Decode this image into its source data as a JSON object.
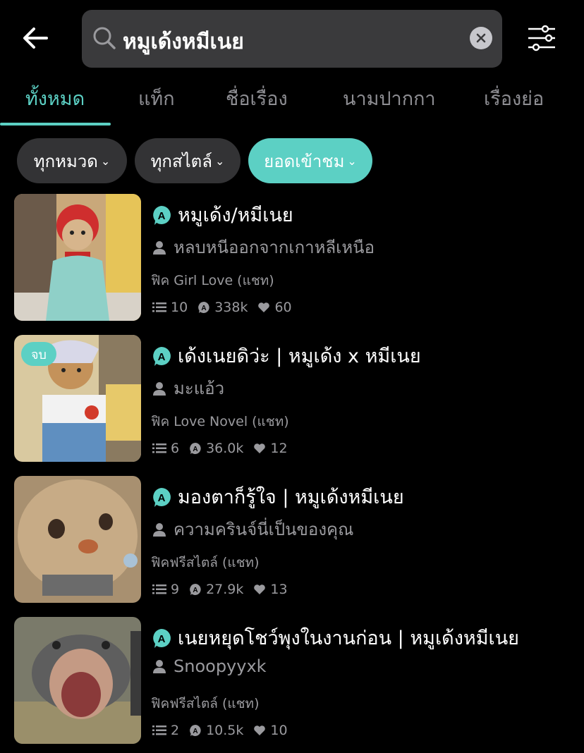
{
  "search": {
    "query": "หมูเด้งหมีเนย"
  },
  "tabs": [
    {
      "label": "ทั้งหมด",
      "active": true
    },
    {
      "label": "แท็ก",
      "active": false
    },
    {
      "label": "ชื่อเรื่อง",
      "active": false
    },
    {
      "label": "นามปากกา",
      "active": false
    },
    {
      "label": "เรื่องย่อ",
      "active": false
    }
  ],
  "filters": [
    {
      "label": "ทุกหมวด",
      "active": false
    },
    {
      "label": "ทุกสไตล์",
      "active": false
    },
    {
      "label": "ยอดเข้าชม",
      "active": true
    }
  ],
  "results": [
    {
      "title": "หมูเด้ง/หมีเนย",
      "author": "หลบหนีออกจากเกาหลีเหนือ",
      "category": "ฟิค Girl Love (แชท)",
      "chapters": "10",
      "views": "338k",
      "likes": "60",
      "badge": ""
    },
    {
      "title": "เด้งเนยดิว่ะ  | หมูเด้ง x หมีเนย",
      "author": "มะแอ้ว",
      "category": "ฟิค Love Novel (แชท)",
      "chapters": "6",
      "views": "36.0k",
      "likes": "12",
      "badge": "จบ"
    },
    {
      "title": "มองตาก็รู้ใจ | หมูเด้งหมีเนย",
      "author": "ความครินจ์นี่เป็นของคุณ",
      "category": "ฟิคฟรีสไตล์ (แชท)",
      "chapters": "9",
      "views": "27.9k",
      "likes": "13",
      "badge": ""
    },
    {
      "title": "เนยหยุดโชว์พุงในงานก่อน | หมูเด้งหมีเนย",
      "author": "Snoopyyxk",
      "category": "ฟิคฟรีสไตล์ (แชท)",
      "chapters": "2",
      "views": "10.5k",
      "likes": "10",
      "badge": ""
    }
  ],
  "colors": {
    "accent": "#5cd0c4",
    "background": "#000000",
    "chip": "#333335",
    "muted": "#9a9a9e"
  }
}
